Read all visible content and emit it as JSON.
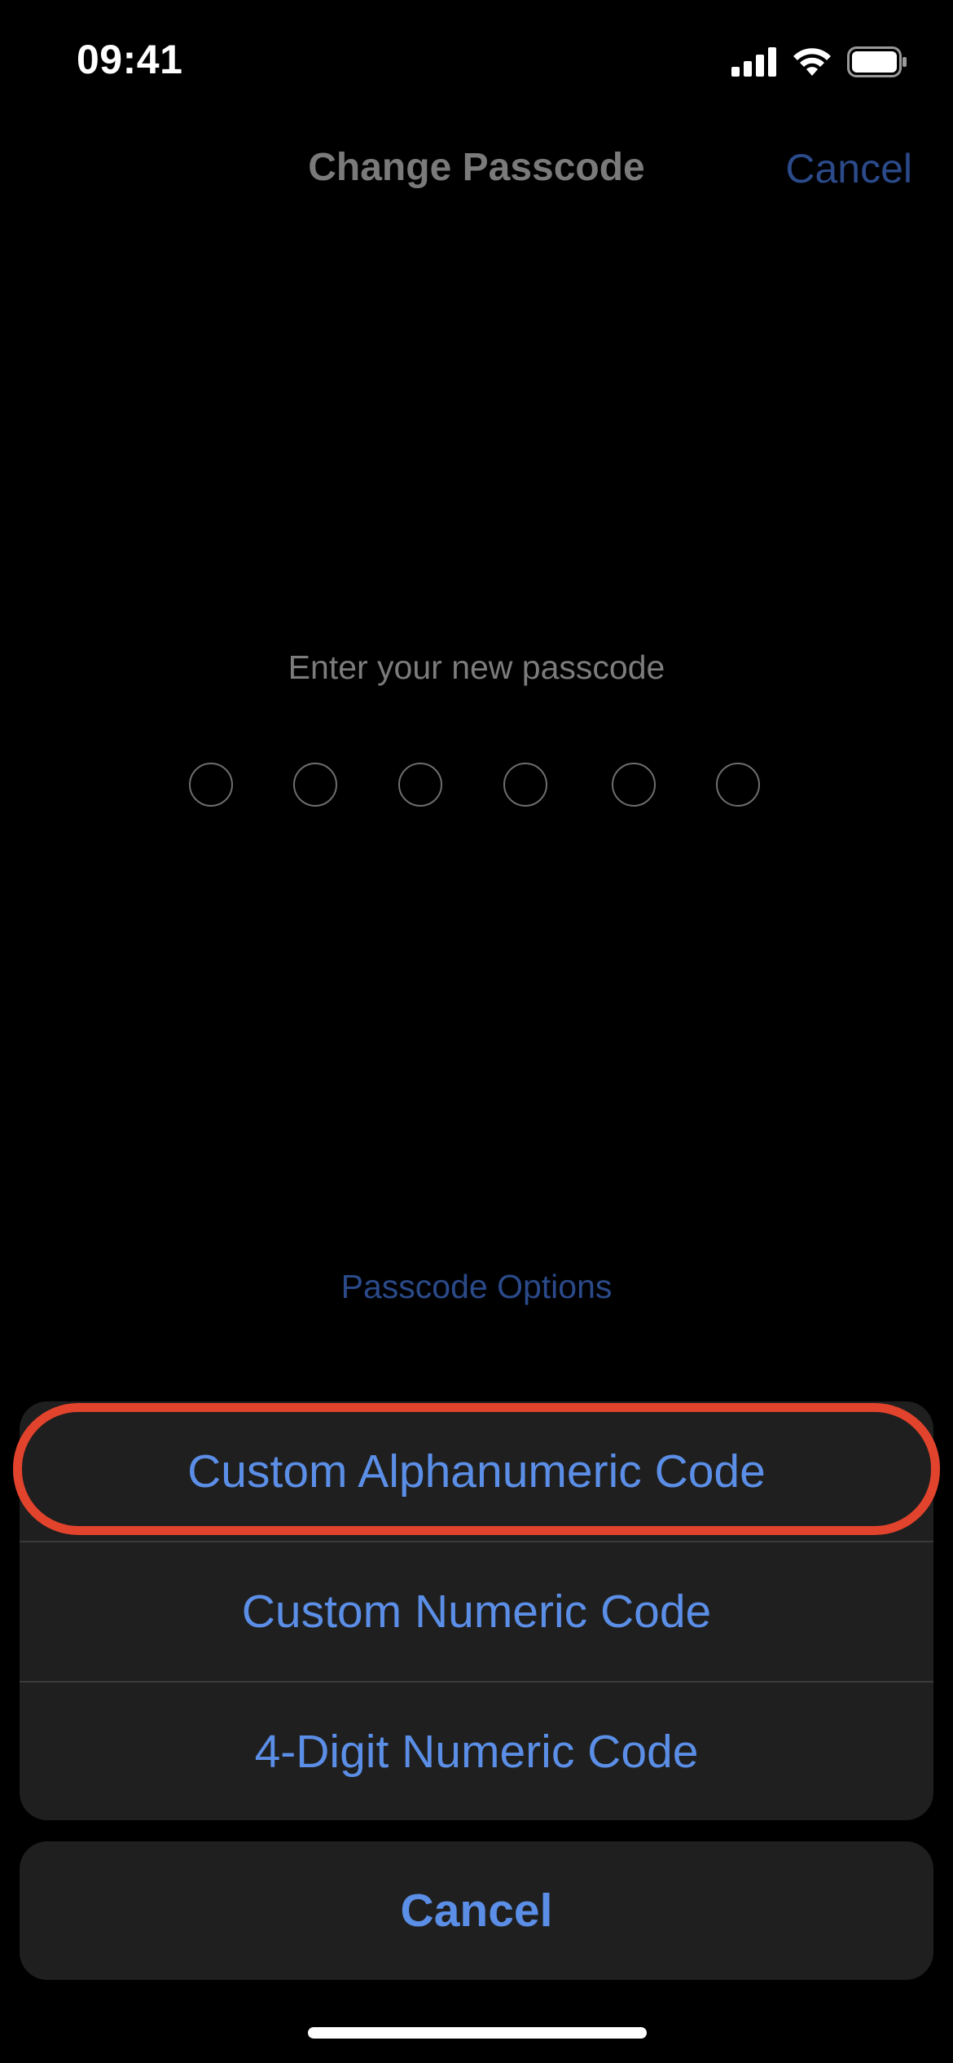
{
  "status_bar": {
    "time": "09:41",
    "icons": [
      "cellular-signal-icon",
      "wifi-icon",
      "battery-icon"
    ]
  },
  "nav": {
    "title": "Change Passcode",
    "cancel_label": "Cancel"
  },
  "passcode": {
    "prompt": "Enter your new passcode",
    "digit_count": 6,
    "entered_count": 0
  },
  "options_link": "Passcode Options",
  "action_sheet": {
    "items": [
      {
        "label": "Custom Alphanumeric Code",
        "highlighted": true
      },
      {
        "label": "Custom Numeric Code",
        "highlighted": false
      },
      {
        "label": "4-Digit Numeric Code",
        "highlighted": false
      }
    ],
    "cancel_label": "Cancel"
  },
  "colors": {
    "accent": "#5b8ee6",
    "dim_accent": "#2b4a8a",
    "highlight_ring": "#e2432c",
    "sheet_background": "#1f1f1f",
    "background": "#000000"
  }
}
